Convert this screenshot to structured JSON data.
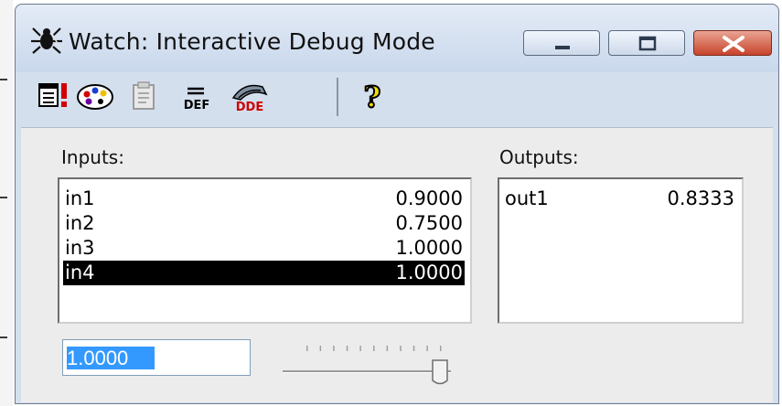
{
  "window": {
    "title": "Watch: Interactive Debug Mode",
    "caption_buttons": [
      "minimize",
      "maximize",
      "close"
    ]
  },
  "toolbar": {
    "icons": [
      "list-alert-icon",
      "palette-icon",
      "export-icon",
      "define-icon",
      "dde-icon",
      "help-icon"
    ],
    "def_text": "DEF",
    "dde_text": "DDE",
    "help_text": "?"
  },
  "inputs": {
    "label": "Inputs:",
    "items": [
      {
        "name": "in1",
        "value": "0.9000"
      },
      {
        "name": "in2",
        "value": "0.7500"
      },
      {
        "name": "in3",
        "value": "1.0000"
      },
      {
        "name": "in4",
        "value": "1.0000"
      }
    ],
    "selected": 3
  },
  "outputs": {
    "label": "Outputs:",
    "items": [
      {
        "name": "out1",
        "value": "0.8333"
      }
    ]
  },
  "editor": {
    "value": "1.0000"
  },
  "slider": {
    "position_fraction": 1.0,
    "tick_count": 11
  },
  "colors": {
    "selection_bg": "#000000",
    "text_highlight": "#3399ff",
    "close_button": "#c8442b"
  }
}
